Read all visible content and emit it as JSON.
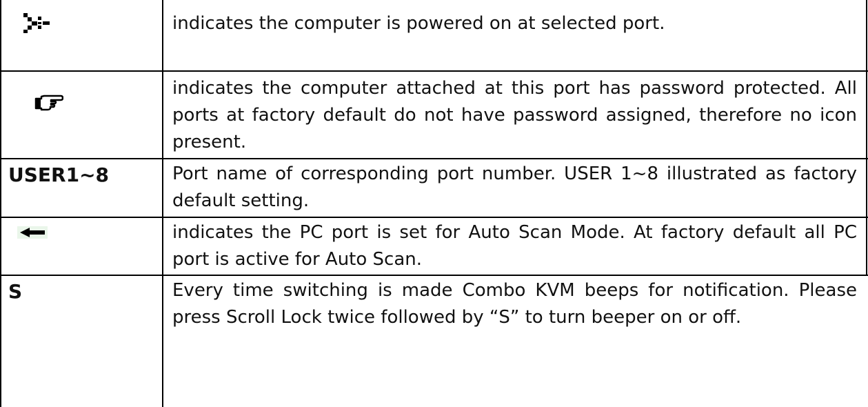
{
  "rows": [
    {
      "icon": "power-on-icon",
      "desc": "indicates the computer is powered on at selected port."
    },
    {
      "icon": "pointing-hand-icon",
      "desc": "indicates the computer attached at this port has password protected. All ports at factory default do not have password assigned, therefore no icon present."
    },
    {
      "key": "USER1~8",
      "desc": "Port name of corresponding port number. USER 1~8 illustrated as factory default setting."
    },
    {
      "icon": "left-arrow-icon",
      "desc": "indicates the PC port is set for Auto Scan Mode. At factory default all PC port is active for Auto Scan."
    },
    {
      "key": "S",
      "desc": "Every time switching is made Combo KVM beeps for notification. Please press Scroll Lock twice followed by “S” to turn beeper on or off."
    }
  ],
  "colors": {
    "text": "#111111",
    "border": "#000000",
    "background": "#ffffff"
  }
}
